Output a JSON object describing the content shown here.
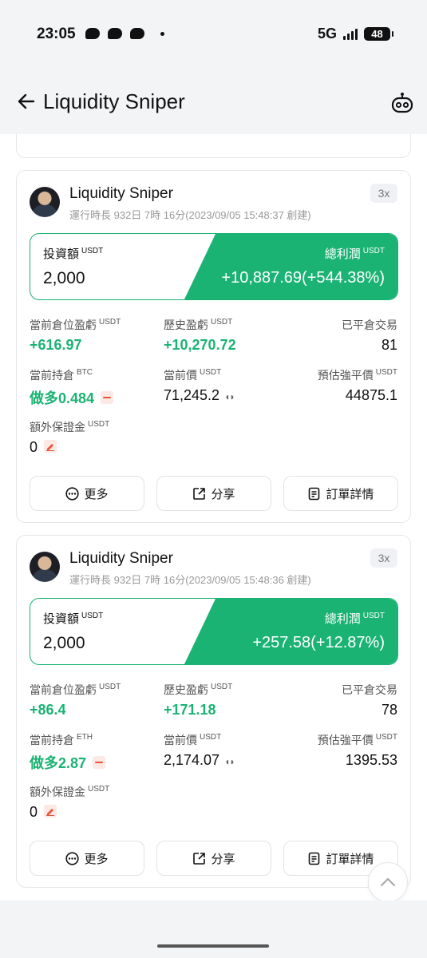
{
  "status_bar": {
    "time": "23:05",
    "network": "5G",
    "battery": "48"
  },
  "header": {
    "title": "Liquidity Sniper"
  },
  "bots": [
    {
      "name": "Liquidity Sniper",
      "runtime": "運行時長 932日 7時 16分(2023/09/05 15:48:37 創建)",
      "leverage": "3x",
      "invest_label": "投資額",
      "invest_unit": "USDT",
      "invest_value": "2,000",
      "profit_label": "總利潤",
      "profit_unit": "USDT",
      "profit_value": "+10,887.69(+544.38%)",
      "pos_pnl_label": "當前倉位盈虧",
      "pos_pnl_unit": "USDT",
      "pos_pnl_value": "+616.97",
      "hist_pnl_label": "歷史盈虧",
      "hist_pnl_unit": "USDT",
      "hist_pnl_value": "+10,270.72",
      "closed_label": "已平倉交易",
      "closed_value": "81",
      "holding_label": "當前持倉",
      "holding_unit": "BTC",
      "holding_value": "做多0.484",
      "price_label": "當前價",
      "price_unit": "USDT",
      "price_value": "71,245.2",
      "liq_label": "預估強平價",
      "liq_unit": "USDT",
      "liq_value": "44875.1",
      "margin_label": "額外保證金",
      "margin_unit": "USDT",
      "margin_value": "0",
      "btn_more": "更多",
      "btn_share": "分享",
      "btn_detail": "訂單詳情"
    },
    {
      "name": "Liquidity Sniper",
      "runtime": "運行時長 932日 7時 16分(2023/09/05 15:48:36 創建)",
      "leverage": "3x",
      "invest_label": "投資額",
      "invest_unit": "USDT",
      "invest_value": "2,000",
      "profit_label": "總利潤",
      "profit_unit": "USDT",
      "profit_value": "+257.58(+12.87%)",
      "pos_pnl_label": "當前倉位盈虧",
      "pos_pnl_unit": "USDT",
      "pos_pnl_value": "+86.4",
      "hist_pnl_label": "歷史盈虧",
      "hist_pnl_unit": "USDT",
      "hist_pnl_value": "+171.18",
      "closed_label": "已平倉交易",
      "closed_value": "78",
      "holding_label": "當前持倉",
      "holding_unit": "ETH",
      "holding_value": "做多2.87",
      "price_label": "當前價",
      "price_unit": "USDT",
      "price_value": "2,174.07",
      "liq_label": "預估強平價",
      "liq_unit": "USDT",
      "liq_value": "1395.53",
      "margin_label": "額外保證金",
      "margin_unit": "USDT",
      "margin_value": "0",
      "btn_more": "更多",
      "btn_share": "分享",
      "btn_detail": "訂單詳情"
    }
  ],
  "colors": {
    "accent_green": "#1bb374",
    "danger": "#e8553a"
  }
}
